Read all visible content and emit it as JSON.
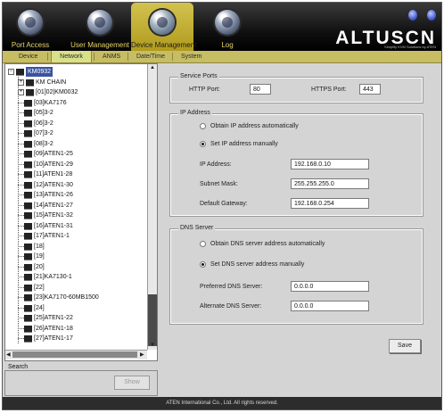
{
  "brand": {
    "name": "ALTUSCN",
    "tagline": "Simplify KVM Solutions by ATEN"
  },
  "nav": [
    {
      "label": "Port Access",
      "icon": "port-access-icon"
    },
    {
      "label": "User Management",
      "icon": "user-management-icon"
    },
    {
      "label": "Device Management",
      "icon": "device-management-icon",
      "active": true
    },
    {
      "label": "Log",
      "icon": "log-icon"
    }
  ],
  "subtabs": [
    "Device",
    "Network",
    "ANMS",
    "Date/Time",
    "System"
  ],
  "active_subtab": "Network",
  "tree": {
    "root": "KM0932",
    "nodes": [
      {
        "label": "KM CHAIN",
        "expander": "+"
      },
      {
        "label": "[01]02|KM0032",
        "expander": "+"
      },
      {
        "label": "[03]KA7176"
      },
      {
        "label": "[05]3-2"
      },
      {
        "label": "[06]3-2"
      },
      {
        "label": "[07]3-2"
      },
      {
        "label": "[08]3-2"
      },
      {
        "label": "[09]ATEN1-25"
      },
      {
        "label": "[10]ATEN1-29"
      },
      {
        "label": "[11]ATEN1-28"
      },
      {
        "label": "[12]ATEN1-30"
      },
      {
        "label": "[13]ATEN1-26"
      },
      {
        "label": "[14]ATEN1-27"
      },
      {
        "label": "[15]ATEN1-32"
      },
      {
        "label": "[16]ATEN1-31"
      },
      {
        "label": "[17]ATEN1-1"
      },
      {
        "label": "[18]"
      },
      {
        "label": "[19]"
      },
      {
        "label": "[20]"
      },
      {
        "label": "[21]KA7130-1"
      },
      {
        "label": "[22]"
      },
      {
        "label": "[23]KA7170-60MB1500"
      },
      {
        "label": "[24]"
      },
      {
        "label": "[25]ATEN1-22"
      },
      {
        "label": "[26]ATEN1-18"
      },
      {
        "label": "[27]ATEN1-17"
      }
    ]
  },
  "search": {
    "label": "Search",
    "show_button": "Show"
  },
  "service_ports": {
    "title": "Service Ports",
    "http_label": "HTTP Port:",
    "http_value": "80",
    "https_label": "HTTPS Port:",
    "https_value": "443"
  },
  "ip_address": {
    "title": "IP Address",
    "auto_label": "Obtain IP address automatically",
    "manual_label": "Set IP address manually",
    "selected": "manual",
    "ip_label": "IP Address:",
    "ip_value": "192.168.0.10",
    "mask_label": "Subnet Mask:",
    "mask_value": "255.255.255.0",
    "gateway_label": "Default Gateway:",
    "gateway_value": "192.168.0.254"
  },
  "dns_server": {
    "title": "DNS Server",
    "auto_label": "Obtain DNS server address automatically",
    "manual_label": "Set DNS server address manually",
    "selected": "manual",
    "preferred_label": "Preferred DNS Server:",
    "preferred_value": "0.0.0.0",
    "alternate_label": "Alternate DNS Server:",
    "alternate_value": "0.0.0.0"
  },
  "save_button": "Save",
  "footer": "ATEN International Co., Ltd. All rights reserved."
}
